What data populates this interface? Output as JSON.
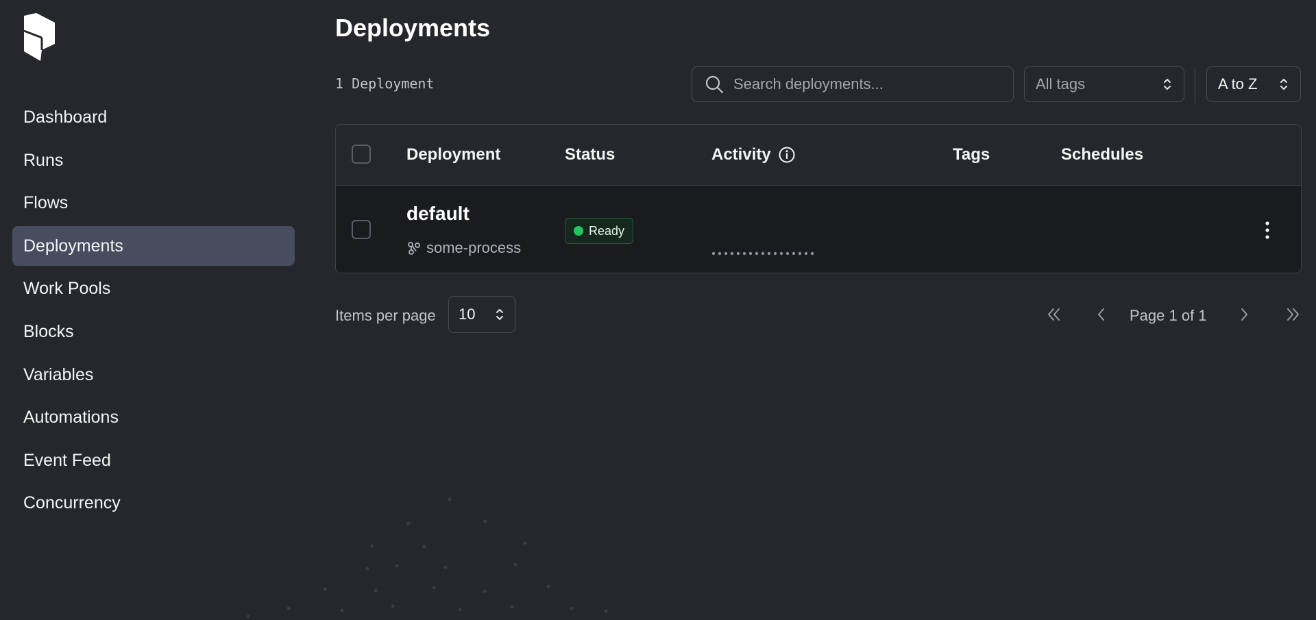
{
  "sidebar": {
    "logo": "prefect-logo",
    "items": [
      {
        "label": "Dashboard"
      },
      {
        "label": "Runs"
      },
      {
        "label": "Flows"
      },
      {
        "label": "Deployments",
        "active": true
      },
      {
        "label": "Work Pools"
      },
      {
        "label": "Blocks"
      },
      {
        "label": "Variables"
      },
      {
        "label": "Automations"
      },
      {
        "label": "Event Feed"
      },
      {
        "label": "Concurrency"
      }
    ]
  },
  "header": {
    "title": "Deployments",
    "count": "1 Deployment"
  },
  "filters": {
    "search_placeholder": "Search deployments...",
    "tags_value": "All tags",
    "sort_value": "A to Z"
  },
  "table": {
    "columns": [
      "Deployment",
      "Status",
      "Activity",
      "Tags",
      "Schedules"
    ],
    "rows": [
      {
        "name": "default",
        "flow": "some-process",
        "status": "Ready",
        "tags": "",
        "schedules": ""
      }
    ]
  },
  "pagination": {
    "items_per_page_label": "Items per page",
    "items_per_page": "10",
    "page_info": "Page 1 of 1"
  },
  "colors": {
    "background": "#26272c",
    "active_nav": "#484c5f",
    "row_background": "#1a1b1e",
    "status_ready": "#22c55e"
  }
}
